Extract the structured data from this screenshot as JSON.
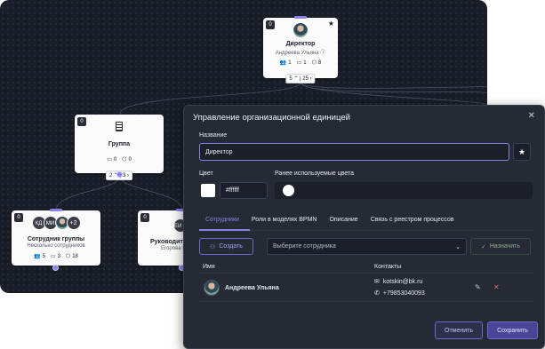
{
  "colors": {
    "accent": "#8a80e8",
    "canvas": "#1a1d27",
    "modal": "#262a35"
  },
  "canvas": {
    "nodes": {
      "director": {
        "badge": "0",
        "title": "Директор",
        "subtitle": "Андреева Ульяна",
        "stat_users": "1",
        "stat_cards": "1",
        "stat_boxes": "8",
        "counter_down": "5",
        "counter_right": "25"
      },
      "group": {
        "badge": "0",
        "title": "Группа",
        "stat_cards": "0",
        "stat_boxes": "0",
        "counter_down": "2",
        "counter_right": "3"
      },
      "employee_group": {
        "badge": "0",
        "avatars": [
          "КД",
          "МИ"
        ],
        "more": "+2",
        "title": "Сотрудник группы",
        "subtitle": "Несколько сотрудников",
        "stat_users": "5",
        "stat_cards": "3",
        "stat_boxes": "18"
      },
      "head": {
        "badge": "0",
        "avatar": "ЕИ",
        "title": "Руководите",
        "subtitle": "Егорова И"
      }
    }
  },
  "modal": {
    "title": "Управление организационной единицей",
    "name_label": "Название",
    "name_value": "Директор",
    "color_label": "Цвет",
    "color_value": "#ffffff",
    "used_colors_label": "Ранее используемые цвета",
    "tabs": [
      "Сотрудники",
      "Роли в моделях BPMN",
      "Описание",
      "Связь с реестром процессов"
    ],
    "create_button": "Создать",
    "select_placeholder": "Выберите сотрудника",
    "assign_button": "Назначить",
    "table": {
      "col_name": "Имя",
      "col_contacts": "Контакты",
      "rows": [
        {
          "name": "Андреева Ульяна",
          "email": "kotskin@bk.ru",
          "phone": "+79853040093"
        }
      ]
    },
    "cancel_button": "Отменить",
    "save_button": "Сохранить"
  }
}
